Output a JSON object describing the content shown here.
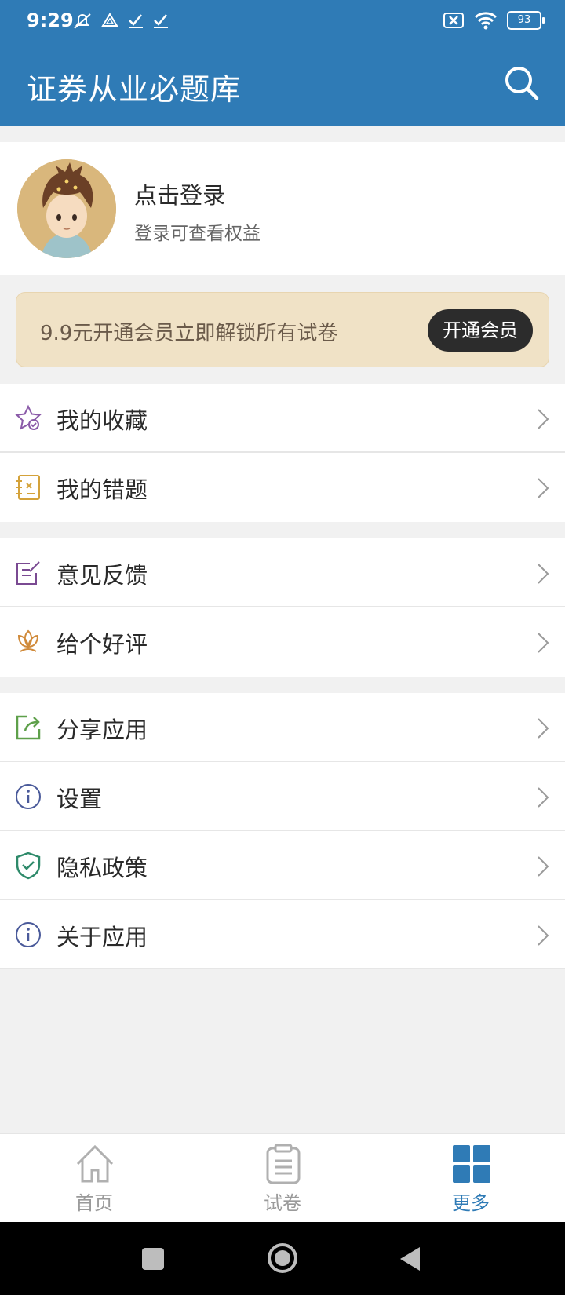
{
  "status_bar": {
    "time": "9:29",
    "battery": "93"
  },
  "app_bar": {
    "title": "证券从业必题库"
  },
  "profile": {
    "login_label": "点击登录",
    "login_hint": "登录可查看权益"
  },
  "vip_banner": {
    "text": "9.9元开通会员立即解锁所有试卷",
    "button_label": "开通会员"
  },
  "menu_groups": [
    {
      "items": [
        {
          "label": "我的收藏",
          "icon": "star-check-icon"
        },
        {
          "label": "我的错题",
          "icon": "wrong-questions-icon"
        }
      ]
    },
    {
      "items": [
        {
          "label": "意见反馈",
          "icon": "feedback-edit-icon"
        },
        {
          "label": "给个好评",
          "icon": "lotus-rating-icon"
        }
      ]
    },
    {
      "items": [
        {
          "label": "分享应用",
          "icon": "share-icon"
        },
        {
          "label": "设置",
          "icon": "info-icon"
        },
        {
          "label": "隐私政策",
          "icon": "shield-check-icon"
        },
        {
          "label": "关于应用",
          "icon": "info-icon"
        }
      ]
    }
  ],
  "tab_bar": {
    "tabs": [
      {
        "label": "首页",
        "icon": "home-icon",
        "active": false
      },
      {
        "label": "试卷",
        "icon": "clipboard-icon",
        "active": false
      },
      {
        "label": "更多",
        "icon": "grid-icon",
        "active": true
      }
    ]
  },
  "colors": {
    "primary": "#2f7bb6",
    "vip_background": "#f0e2c6",
    "vip_button": "#2c2c2c"
  }
}
